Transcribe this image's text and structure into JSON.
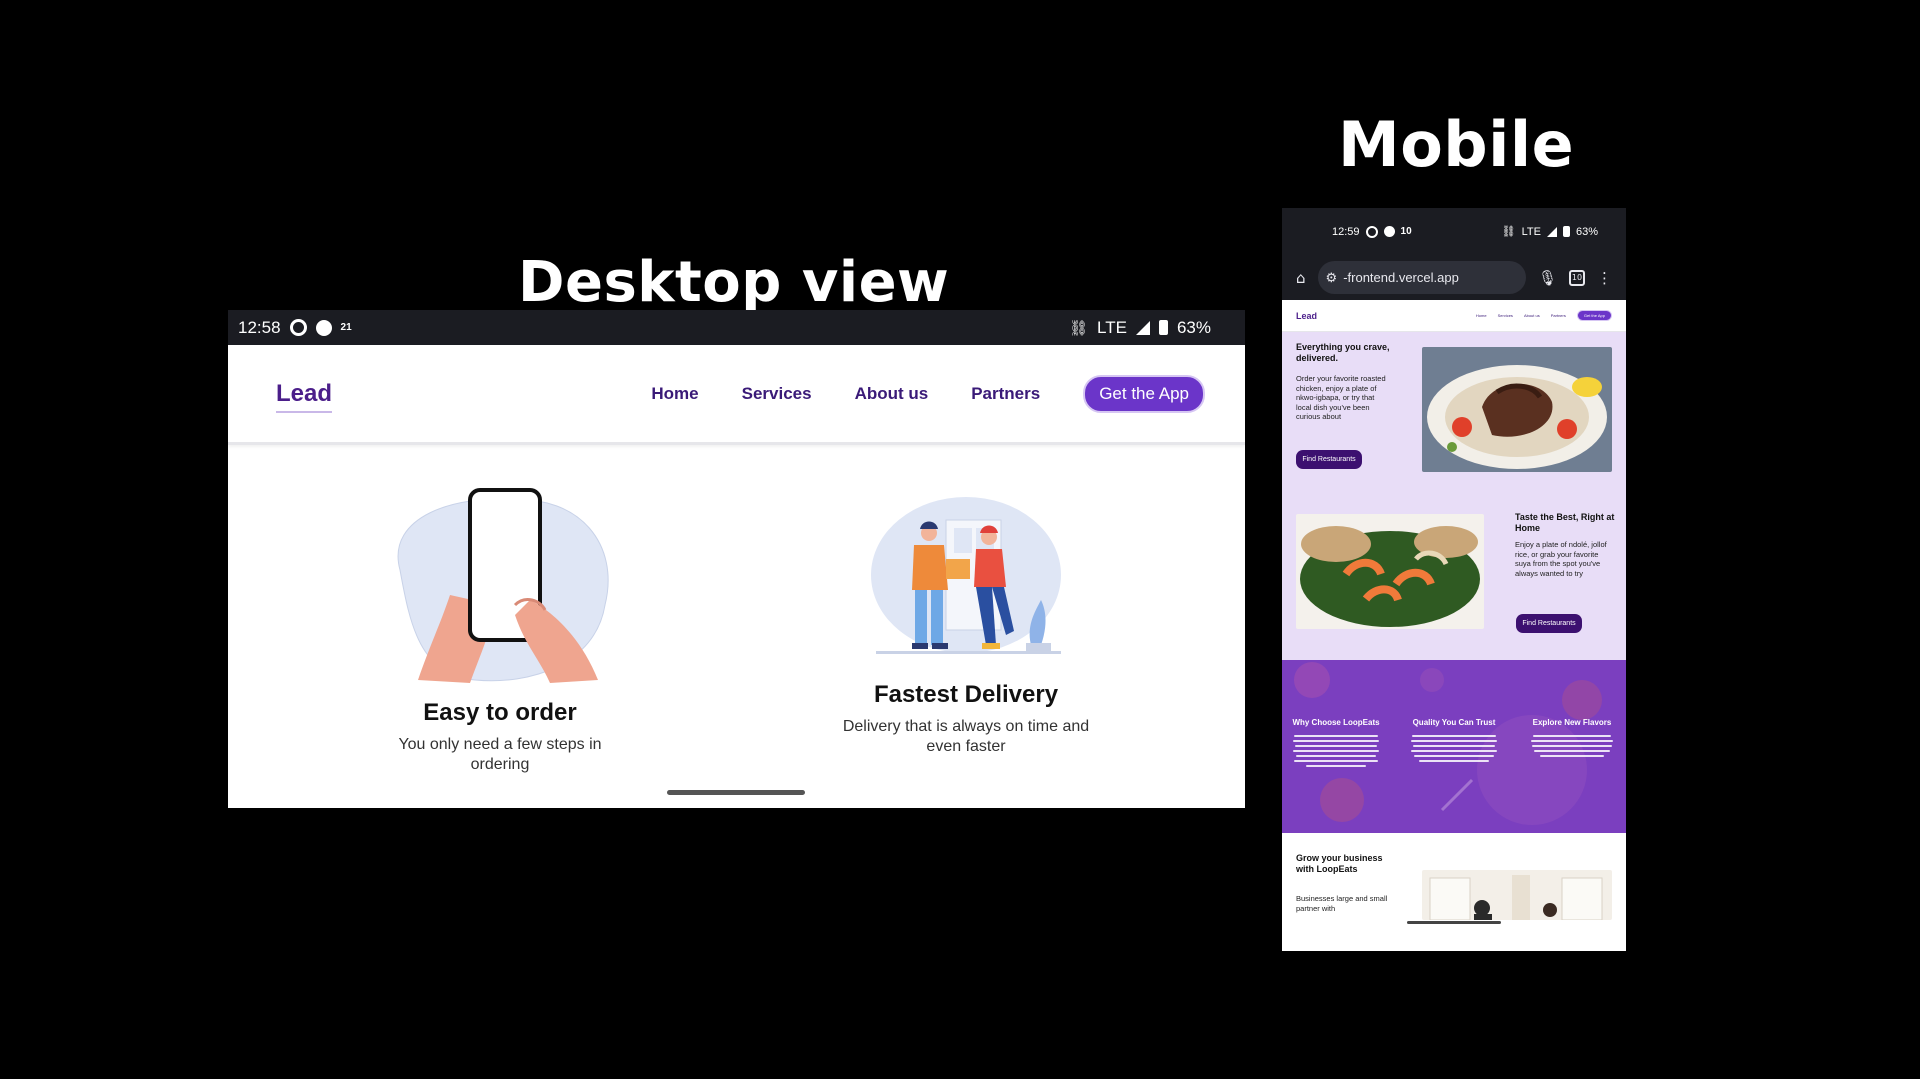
{
  "headings": {
    "desktop": "Desktop  view",
    "mobile": "Mobile"
  },
  "desktop": {
    "status": {
      "time": "12:58",
      "small_badge": "21",
      "network": "LTE",
      "battery": "63%"
    },
    "brand": "Lead",
    "nav": [
      "Home",
      "Services",
      "About us",
      "Partners"
    ],
    "cta": "Get the App",
    "features": [
      {
        "title": "Easy to order",
        "desc": "You only need a few steps in ordering"
      },
      {
        "title": "Fastest Delivery",
        "desc": "Delivery that is always on time and even faster"
      }
    ]
  },
  "mobile": {
    "status": {
      "time": "12:59",
      "small_badge": "10",
      "network": "LTE",
      "battery": "63%"
    },
    "browser": {
      "url": "-frontend.vercel.app",
      "tab_count": "10"
    },
    "brand": "Lead",
    "nav": [
      "Home",
      "Services",
      "About us",
      "Partners"
    ],
    "cta": "Get the App",
    "hero": {
      "title": "Everything you crave, delivered.",
      "text": "Order your favorite roasted chicken, enjoy a plate of nkwo-igbapa, or try that local dish you've been curious about",
      "button": "Find Restaurants"
    },
    "home": {
      "title": "Taste the Best, Right at Home",
      "text": "Enjoy a plate of ndolé, jollof rice, or grab your favorite suya from the spot you've always wanted to try",
      "button": "Find Restaurants"
    },
    "why": [
      {
        "title": "Why Choose LoopEats"
      },
      {
        "title": "Quality You Can Trust"
      },
      {
        "title": "Explore New Flavors"
      }
    ],
    "grow": {
      "title": "Grow your business with LoopEats",
      "text": "Businesses large and small partner with"
    }
  },
  "colors": {
    "brand": "#4b1e8a",
    "accent": "#6b35c9",
    "lavender": "#e8ddf7",
    "why_bg": "#7b3fbf"
  }
}
